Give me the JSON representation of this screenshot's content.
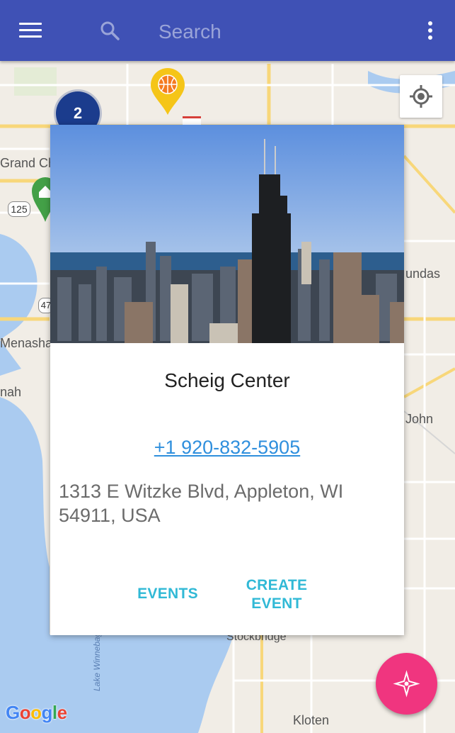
{
  "topbar": {
    "search_placeholder": "Search",
    "background_color": "#3f51b5",
    "icons": [
      "menu-icon",
      "search-icon",
      "more-vert-icon"
    ]
  },
  "map": {
    "labels": {
      "grand_chute": "Grand Ch",
      "highway_125": "125",
      "highway_47": "47",
      "menasha": "Menasha",
      "nah": "nah",
      "kaukauna_dundas": "undas",
      "john": "John",
      "stockbridge": "Stockbridge",
      "kloten": "Kloten",
      "lake_winnebago": "Lake Winnebago"
    },
    "cluster_count": "2",
    "google_logo": [
      "G",
      "o",
      "o",
      "g",
      "l",
      "e"
    ]
  },
  "card": {
    "title": "Scheig Center",
    "phone": "+1 920-832-5905",
    "address": "1313 E Witzke Blvd, Appleton, WI 54911, USA",
    "events_label": "EVENTS",
    "create_event_label": "CREATE EVENT",
    "accent_color": "#31b9d6",
    "link_color": "#2f8fdd"
  },
  "fab": {
    "icon": "compass-icon",
    "color": "#f0357f"
  }
}
